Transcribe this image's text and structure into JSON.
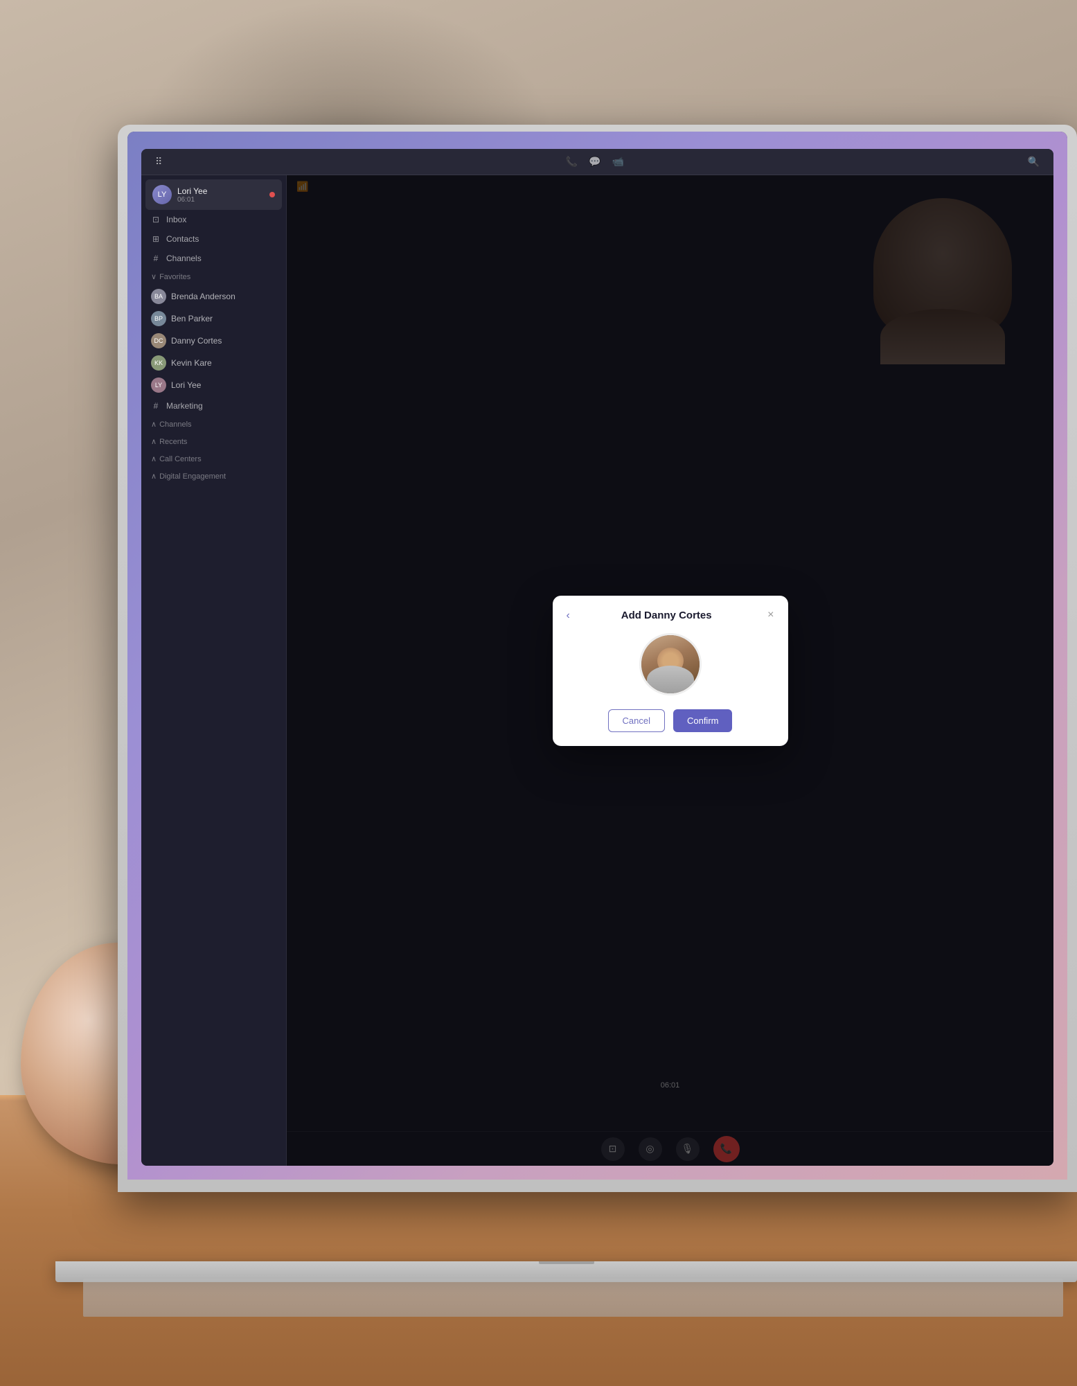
{
  "scene": {
    "background_description": "Laptop on wooden desk with decorative sphere"
  },
  "app": {
    "nav": {
      "icons": [
        "phone-icon",
        "chat-icon",
        "video-icon",
        "search-icon"
      ]
    },
    "sidebar": {
      "active_contact": {
        "name": "Lori Yee",
        "time": "06:01",
        "avatar_initials": "LY"
      },
      "nav_items": [
        {
          "label": "Inbox",
          "icon": "inbox-icon"
        },
        {
          "label": "Contacts",
          "icon": "contacts-icon"
        }
      ],
      "channels_label": "Channels",
      "sections": {
        "favorites": {
          "label": "Favorites",
          "items": [
            {
              "name": "Brenda Anderson",
              "color": "#888899"
            },
            {
              "name": "Ben Parker",
              "color": "#778899"
            },
            {
              "name": "Danny Cortes",
              "color": "#998877"
            },
            {
              "name": "Kevin Kare",
              "color": "#889977"
            },
            {
              "name": "Lori Yee",
              "color": "#997788"
            }
          ]
        },
        "marketing": {
          "label": "Marketing"
        },
        "channels": {
          "label": "Channels"
        },
        "recents": {
          "label": "Recents"
        },
        "call_centers": {
          "label": "Call Centers"
        },
        "digital_engagement": {
          "label": "Digital Engagement"
        }
      }
    },
    "call": {
      "timer": "06:01",
      "controls": [
        "screen-share-icon",
        "camera-icon",
        "mic-icon",
        "end-call-icon"
      ]
    },
    "modal": {
      "title": "Add Danny Cortes",
      "back_label": "‹",
      "close_label": "×",
      "cancel_label": "Cancel",
      "confirm_label": "Confirm",
      "avatar_alt": "Danny Cortes avatar"
    }
  }
}
